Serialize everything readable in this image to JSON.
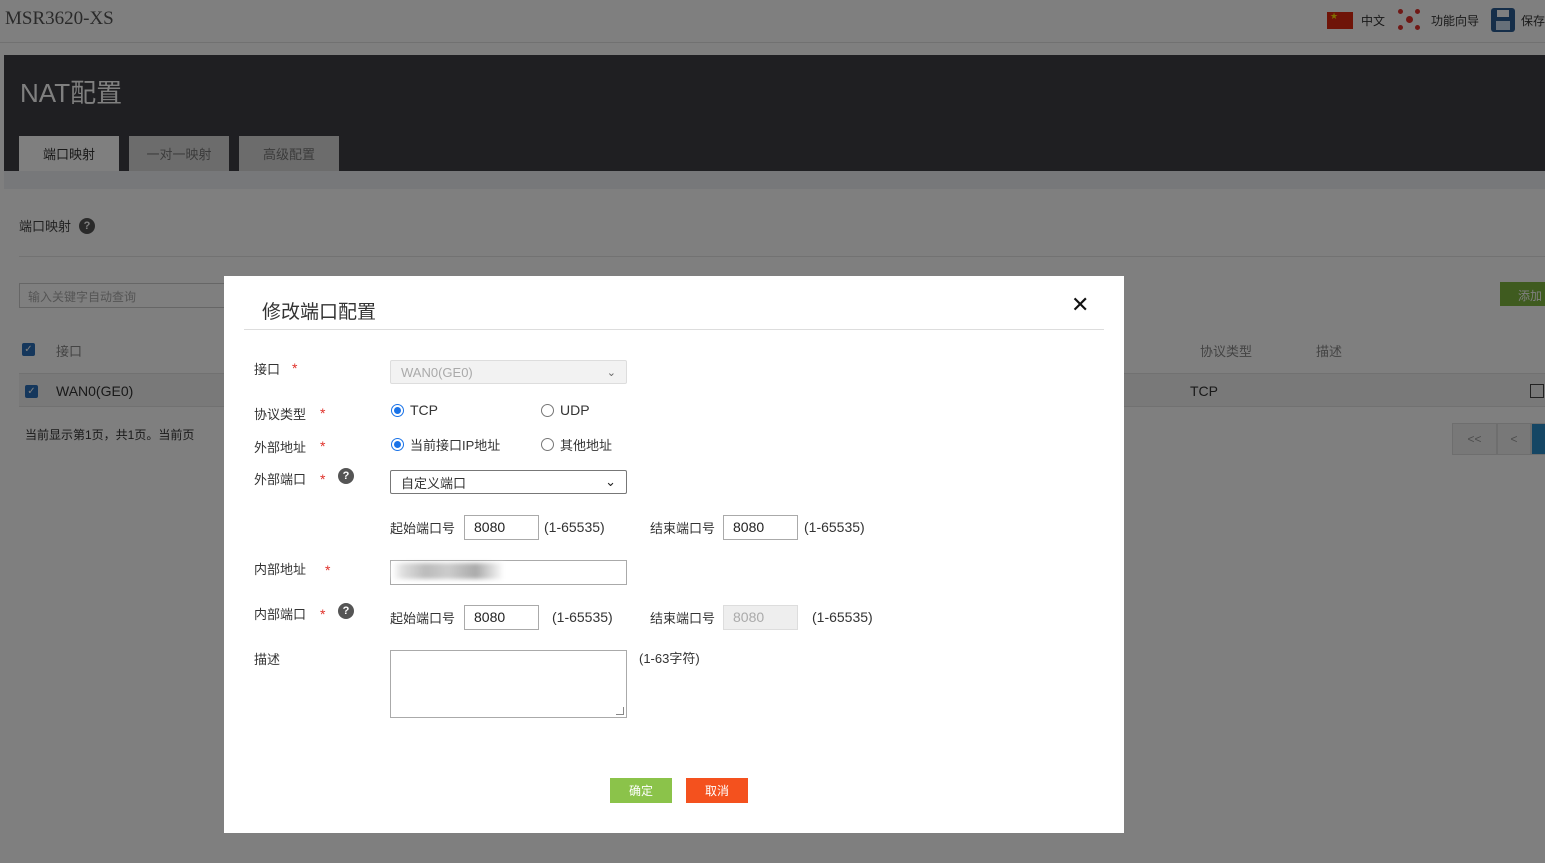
{
  "top": {
    "device": "MSR3620-XS",
    "lang": "中文",
    "wizard": "功能向导",
    "save": "保存"
  },
  "page": {
    "title": "NAT配置",
    "tabs": [
      "端口映射",
      "一对一映射",
      "高级配置"
    ],
    "section": "端口映射",
    "search_placeholder": "输入关键字自动查询",
    "add": "添加",
    "columns": [
      "接口",
      "协议类型",
      "描述"
    ],
    "row": {
      "interface": "WAN0(GE0)",
      "protocol": "TCP"
    },
    "page_info": "当前显示第1页，共1页。当前页",
    "pager": [
      "<<",
      "<"
    ]
  },
  "modal": {
    "title": "修改端口配置",
    "interface_label": "接口",
    "interface_value": "WAN0(GE0)",
    "protocol_label": "协议类型",
    "protocol_options": [
      "TCP",
      "UDP"
    ],
    "protocol_selected": "TCP",
    "ext_addr_label": "外部地址",
    "ext_addr_options": [
      "当前接口IP地址",
      "其他地址"
    ],
    "ext_port_label": "外部端口",
    "ext_port_mode": "自定义端口",
    "start_port_label": "起始端口号",
    "end_port_label": "结束端口号",
    "ext_start": "8080",
    "ext_end": "8080",
    "port_range": "(1-65535)",
    "int_addr_label": "内部地址",
    "int_port_label": "内部端口",
    "int_start": "8080",
    "int_end": "8080",
    "desc_label": "描述",
    "desc_hint": "(1-63字符)",
    "ok": "确定",
    "cancel": "取消"
  },
  "colors": {
    "accent": "#1a73e8",
    "ok": "#8bc34a",
    "cancel": "#f4511e",
    "header": "#3f3f45"
  }
}
